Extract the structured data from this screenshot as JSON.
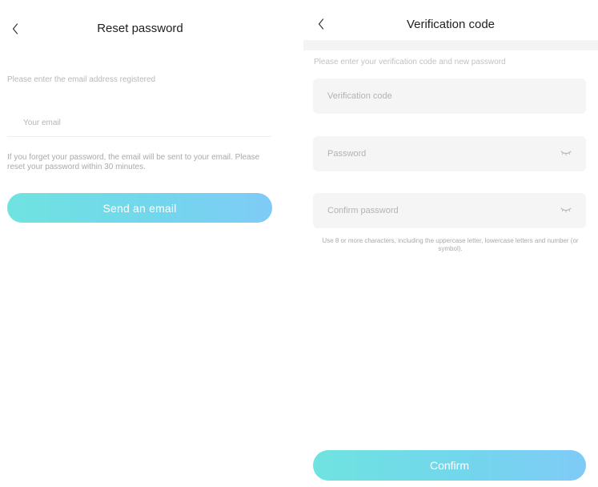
{
  "reset_screen": {
    "back_icon": "chevron-left-icon",
    "title": "Reset password",
    "instruction": "Please enter the email address registered",
    "email_placeholder": "Your email",
    "note": "If you forget your password, the email will be sent to your email. Please reset your password within 30 minutes.",
    "send_button_label": "Send an email"
  },
  "verification_screen": {
    "back_icon": "chevron-left-icon",
    "title": "Verification code",
    "instruction": "Please enter your verification code and new password",
    "code_placeholder": "Verification code",
    "password_placeholder": "Password",
    "confirm_password_placeholder": "Confirm password",
    "visibility_icon": "eye-closed-icon",
    "password_rules": "Use 8 or more characters, including the uppercase letter, lowercase letters and number (or symbol).",
    "confirm_button_label": "Confirm"
  },
  "colors": {
    "button_gradient_start": "#6fe3e0",
    "button_gradient_end": "#7fcbf7",
    "field_background": "#f5f5f5",
    "hint_text": "#b8b8b8"
  }
}
